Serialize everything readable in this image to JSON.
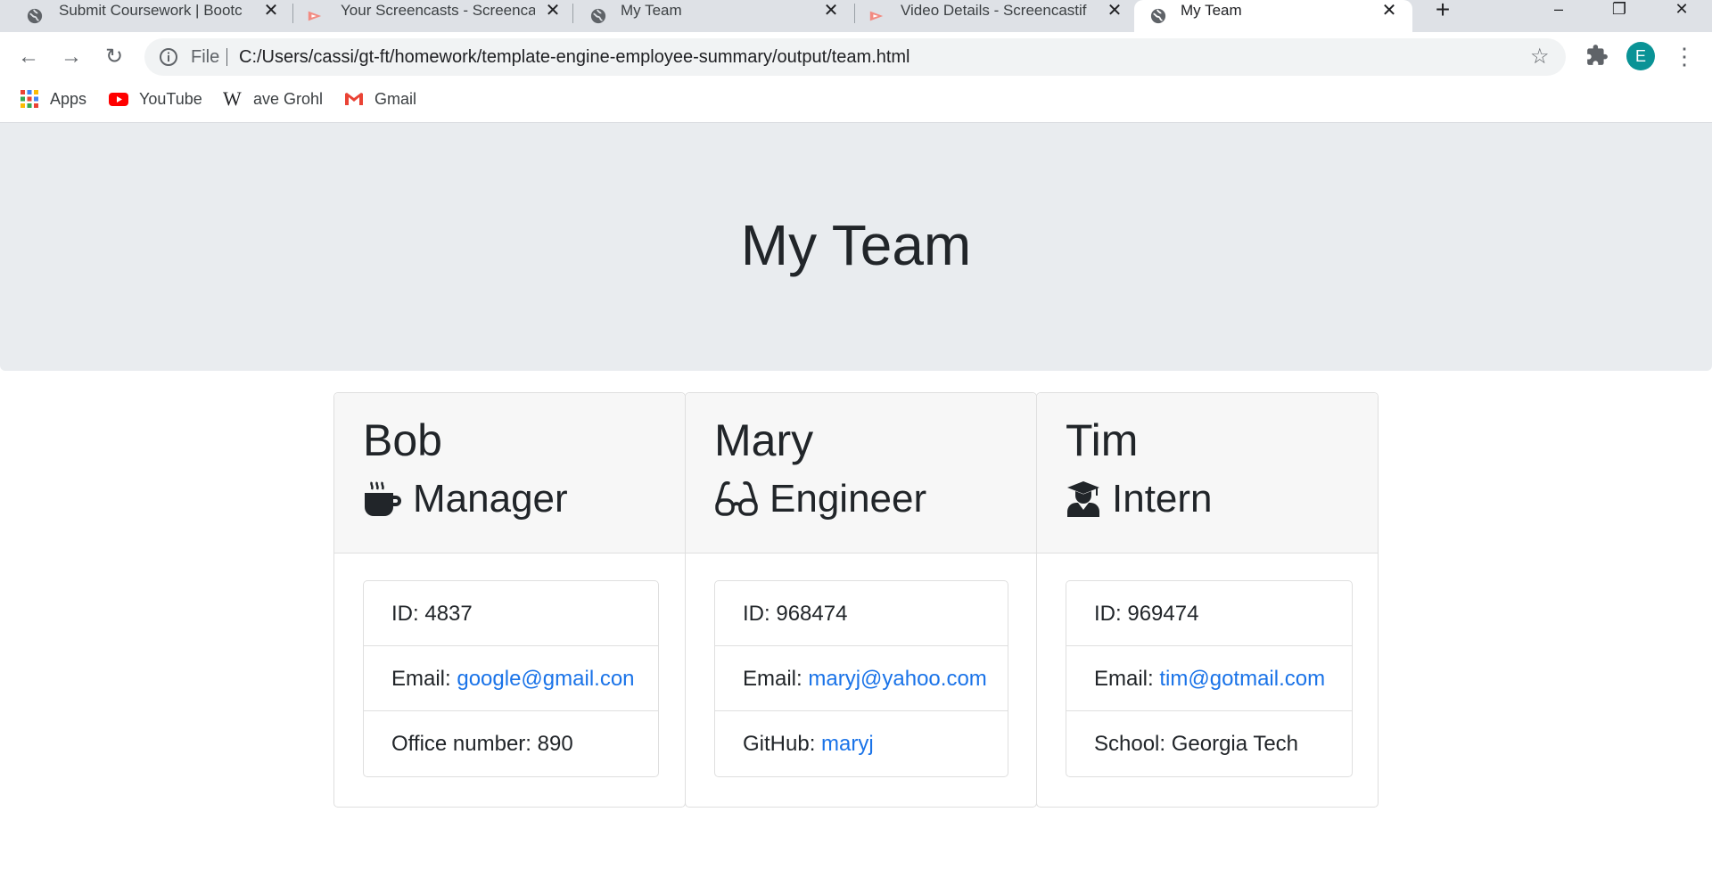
{
  "browser": {
    "tabs": [
      {
        "title": "Submit Coursework | Bootc",
        "icon": "globe-icon"
      },
      {
        "title": "Your Screencasts - Screenca",
        "icon": "screencastify-icon"
      },
      {
        "title": "My Team",
        "icon": "globe-icon"
      },
      {
        "title": "Video Details - Screencastif",
        "icon": "screencastify-icon"
      },
      {
        "title": "My Team",
        "icon": "globe-icon",
        "active": true
      }
    ],
    "address": {
      "scheme": "File",
      "url": "C:/Users/cassi/gt-ft/homework/template-engine-employee-summary/output/team.html"
    },
    "profile_initial": "E",
    "bookmarks": [
      {
        "label": "Apps",
        "icon": "apps-grid-icon"
      },
      {
        "label": "YouTube",
        "icon": "youtube-icon"
      },
      {
        "label": "ave Grohl",
        "icon": "wikipedia-icon"
      },
      {
        "label": "Gmail",
        "icon": "gmail-icon"
      }
    ]
  },
  "page": {
    "heading": "My Team",
    "employees": [
      {
        "name": "Bob",
        "role": "Manager",
        "role_icon": "mug-icon",
        "id_label": "ID: ",
        "id": "4837",
        "email_label": "Email: ",
        "email": "google@gmail.con",
        "extra_label": "Office number: ",
        "extra_value": "890",
        "extra_is_link": false
      },
      {
        "name": "Mary",
        "role": "Engineer",
        "role_icon": "glasses-icon",
        "id_label": "ID: ",
        "id": "968474",
        "email_label": "Email: ",
        "email": "maryj@yahoo.com",
        "extra_label": "GitHub: ",
        "extra_value": "maryj",
        "extra_is_link": true
      },
      {
        "name": "Tim",
        "role": "Intern",
        "role_icon": "graduate-icon",
        "id_label": "ID: ",
        "id": "969474",
        "email_label": "Email: ",
        "email": "tim@gotmail.com",
        "extra_label": "School: ",
        "extra_value": "Georgia Tech",
        "extra_is_link": false
      }
    ]
  },
  "colors": {
    "jumbotron_bg": "#e9ecef",
    "link": "#1a73e8",
    "card_header_bg": "#f7f7f7"
  }
}
